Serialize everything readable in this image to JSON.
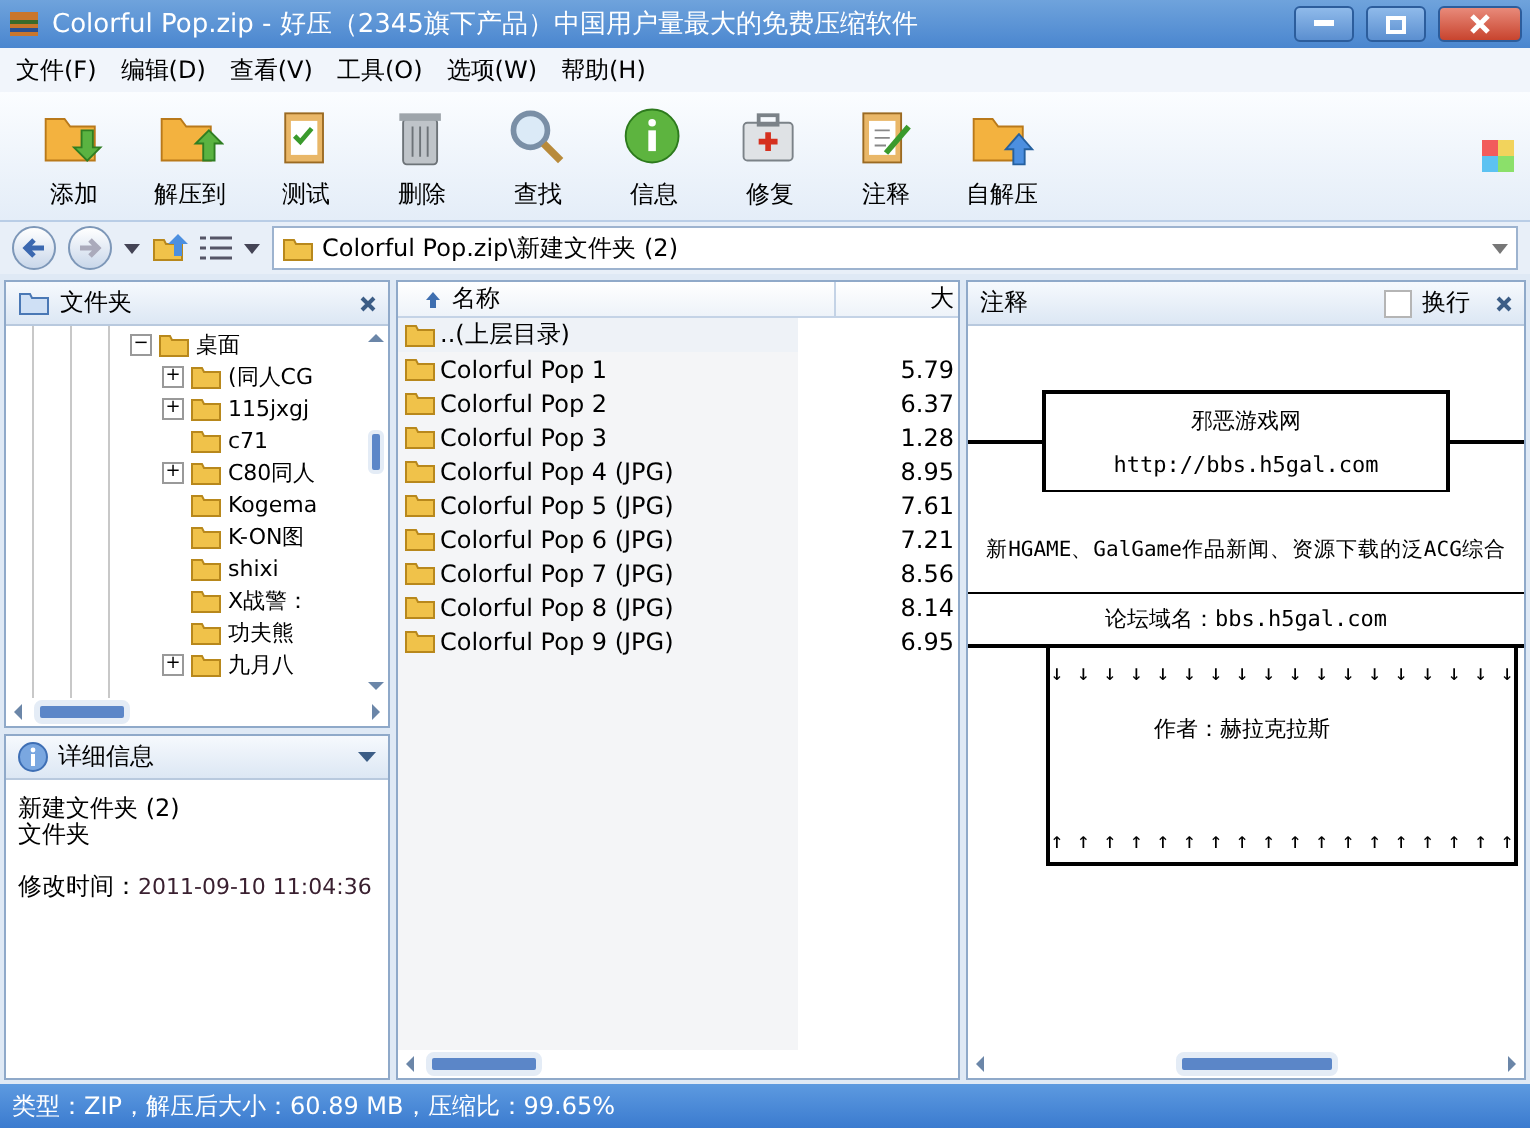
{
  "window": {
    "title": "Colorful Pop.zip - 好压（2345旗下产品）中国用户量最大的免费压缩软件"
  },
  "menu": [
    "文件(F)",
    "编辑(D)",
    "查看(V)",
    "工具(O)",
    "选项(W)",
    "帮助(H)"
  ],
  "toolbar": [
    "添加",
    "解压到",
    "测试",
    "删除",
    "查找",
    "信息",
    "修复",
    "注释",
    "自解压"
  ],
  "address": {
    "path": "Colorful Pop.zip\\新建文件夹 (2)"
  },
  "folder_pane": {
    "title": "文件夹",
    "tree": [
      {
        "label": "桌面",
        "expander": "−",
        "children": [
          {
            "label": "(同人CG",
            "expander": "+"
          },
          {
            "label": "115jxgj",
            "expander": "+"
          },
          {
            "label": "c71"
          },
          {
            "label": "C80同人",
            "expander": "+"
          },
          {
            "label": "Kogema"
          },
          {
            "label": "K-ON图"
          },
          {
            "label": "shixi"
          },
          {
            "label": "X战警："
          },
          {
            "label": "功夫熊"
          },
          {
            "label": "九月八",
            "expander": "+"
          }
        ]
      }
    ]
  },
  "details": {
    "title": "详细信息",
    "name": "新建文件夹 (2)",
    "type": "文件夹",
    "modified_label": "修改时间：",
    "modified": "2011-09-10 11:04:36"
  },
  "file_list": {
    "columns": [
      "名称",
      "大"
    ],
    "parent_row": "..(上层目录)",
    "rows": [
      {
        "name": "Colorful Pop 1",
        "size": "5.79"
      },
      {
        "name": "Colorful Pop 2",
        "size": "6.37"
      },
      {
        "name": "Colorful Pop 3",
        "size": "1.28"
      },
      {
        "name": "Colorful Pop 4 (JPG)",
        "size": "8.95"
      },
      {
        "name": "Colorful Pop 5 (JPG)",
        "size": "7.61"
      },
      {
        "name": "Colorful Pop 6 (JPG)",
        "size": "7.21"
      },
      {
        "name": "Colorful Pop 7 (JPG)",
        "size": "8.56"
      },
      {
        "name": "Colorful Pop 8 (JPG)",
        "size": "8.14"
      },
      {
        "name": "Colorful Pop 9 (JPG)",
        "size": "6.95"
      }
    ]
  },
  "comment_pane": {
    "title": "注释",
    "wrap_label": "换行",
    "wrap_checked": false,
    "site_name": "邪恶游戏网",
    "site_url": "http://bbs.h5gal.com",
    "tagline": "新HGAME、GalGame作品新闻、资源下载的泛ACG综合",
    "forum": "论坛域名：bbs.h5gal.com",
    "down_arrows": "↓ ↓ ↓ ↓ ↓ ↓ ↓ ↓ ↓ ↓ ↓ ↓ ↓ ↓ ↓ ↓ ↓ ↓",
    "author": "作者：赫拉克拉斯",
    "up_arrows": "↑ ↑ ↑ ↑ ↑ ↑ ↑ ↑ ↑ ↑ ↑ ↑ ↑ ↑ ↑ ↑ ↑ ↑"
  },
  "status_bar": "类型：ZIP，解压后大小：60.89 MB，压缩比：99.65%"
}
